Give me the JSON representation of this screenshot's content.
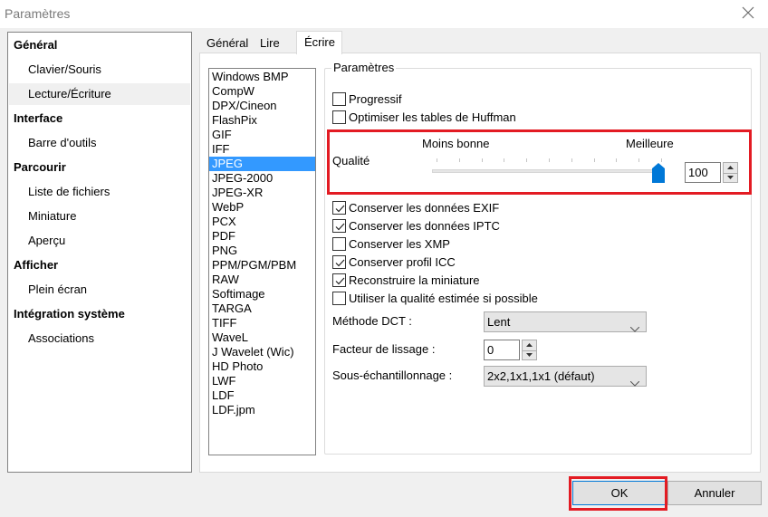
{
  "window": {
    "title": "Paramètres",
    "close_icon": "close-icon"
  },
  "nav": {
    "items": [
      {
        "label": "Général",
        "type": "group"
      },
      {
        "label": "Clavier/Souris",
        "type": "child"
      },
      {
        "label": "Lecture/Écriture",
        "type": "child",
        "selected": true
      },
      {
        "label": "Interface",
        "type": "group"
      },
      {
        "label": "Barre d'outils",
        "type": "child"
      },
      {
        "label": "Parcourir",
        "type": "group"
      },
      {
        "label": "Liste de fichiers",
        "type": "child"
      },
      {
        "label": "Miniature",
        "type": "child"
      },
      {
        "label": "Aperçu",
        "type": "child"
      },
      {
        "label": "Afficher",
        "type": "group"
      },
      {
        "label": "Plein écran",
        "type": "child"
      },
      {
        "label": "Intégration système",
        "type": "group"
      },
      {
        "label": "Associations",
        "type": "child"
      }
    ]
  },
  "tabs": [
    {
      "label": "Général"
    },
    {
      "label": "Lire"
    },
    {
      "label": "Écrire",
      "active": true
    }
  ],
  "formats": {
    "selected": "JPEG",
    "items": [
      "Windows BMP",
      "CompW",
      "DPX/Cineon",
      "FlashPix",
      "GIF",
      "IFF",
      "JPEG",
      "JPEG-2000",
      "JPEG-XR",
      "WebP",
      "PCX",
      "PDF",
      "PNG",
      "PPM/PGM/PBM",
      "RAW",
      "Softimage",
      "TARGA",
      "TIFF",
      "WaveL",
      "J Wavelet (Wic)",
      "HD Photo",
      "LWF",
      "LDF",
      "LDF.jpm"
    ]
  },
  "settings": {
    "group_label": "Paramètres",
    "progressive": {
      "label": "Progressif",
      "checked": false
    },
    "optimize_huffman": {
      "label": "Optimiser les tables de Huffman",
      "checked": false
    },
    "quality": {
      "label": "Qualité",
      "min_label": "Moins bonne",
      "max_label": "Meilleure",
      "value": "100",
      "slider_percent": 100
    },
    "checkboxes": [
      {
        "label": "Conserver les données EXIF",
        "checked": true
      },
      {
        "label": "Conserver les données IPTC",
        "checked": true
      },
      {
        "label": "Conserver les XMP",
        "checked": false
      },
      {
        "label": "Conserver profil ICC",
        "checked": true
      },
      {
        "label": "Reconstruire la miniature",
        "checked": true
      },
      {
        "label": "Utiliser la qualité estimée si possible",
        "checked": false
      }
    ],
    "dct_method": {
      "label": "Méthode DCT :",
      "value": "Lent"
    },
    "smoothing": {
      "label": "Facteur de lissage :",
      "value": "0"
    },
    "subsampling": {
      "label": "Sous-échantillonnage :",
      "value": "2x2,1x1,1x1 (défaut)"
    }
  },
  "buttons": {
    "ok": "OK",
    "cancel": "Annuler"
  },
  "colors": {
    "highlight": "#e31b23",
    "selection": "#3399ff",
    "accent": "#0078d7"
  }
}
